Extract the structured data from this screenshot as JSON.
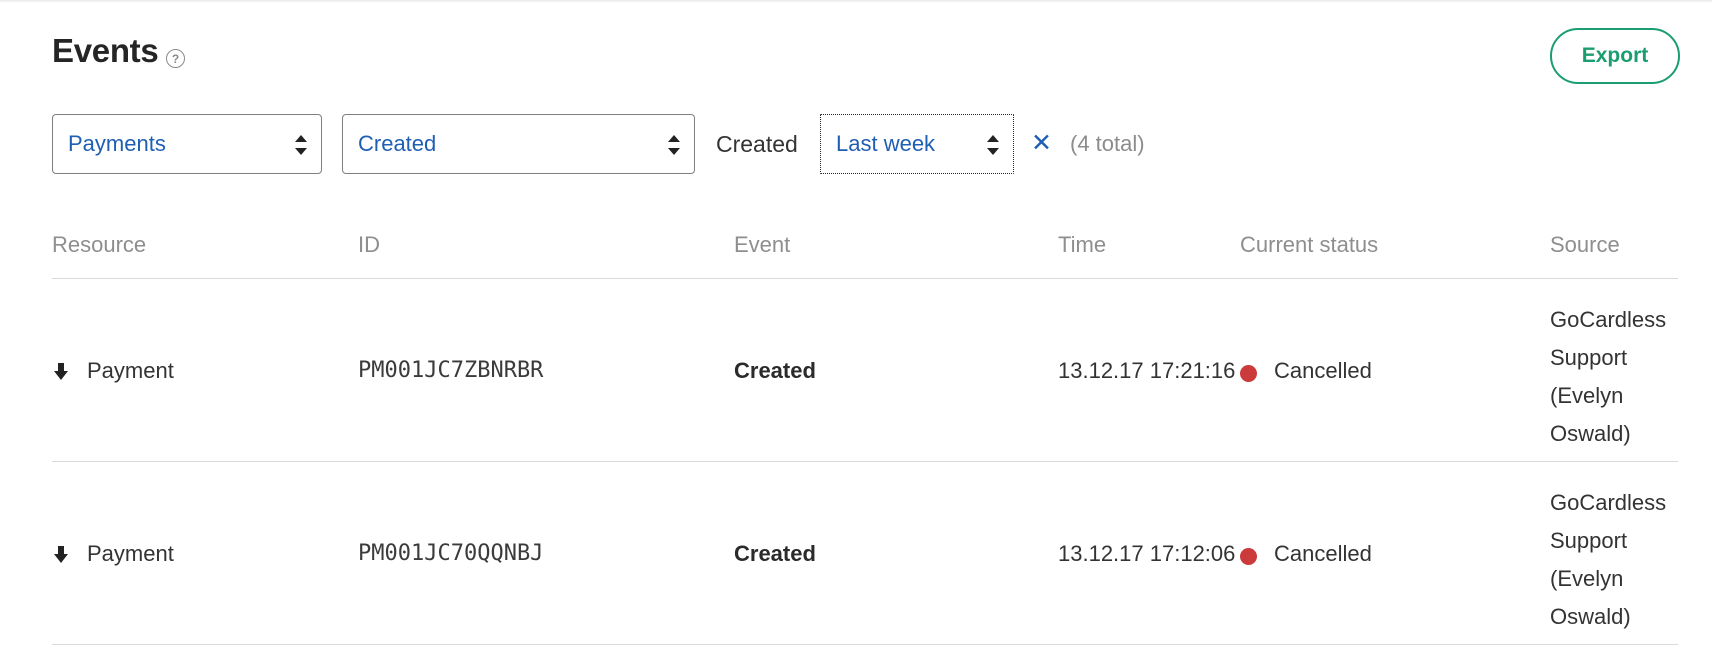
{
  "header": {
    "title": "Events",
    "help_icon": "question-circle-icon",
    "help_glyph": "?",
    "export_label": "Export"
  },
  "filters": {
    "resource_value": "Payments",
    "action_value": "Created",
    "range_label": "Created",
    "range_value": "Last week",
    "clear_icon": "close-icon",
    "clear_glyph": "✕",
    "total_text": "(4 total)"
  },
  "table": {
    "headers": [
      "Resource",
      "ID",
      "Event",
      "Time",
      "Current status",
      "Source"
    ],
    "rows": [
      {
        "resource_icon": "arrow-down-icon",
        "resource": "Payment",
        "id": "PM001JC7ZBNRBR",
        "event": "Created",
        "time": "13.12.17 17:21:16",
        "status": "Cancelled",
        "status_color": "#cc3b3b",
        "source_lines": [
          "GoCardless",
          "Support",
          "(Evelyn",
          "Oswald)"
        ]
      },
      {
        "resource_icon": "arrow-down-icon",
        "resource": "Payment",
        "id": "PM001JC70QQNBJ",
        "event": "Created",
        "time": "13.12.17 17:12:06",
        "status": "Cancelled",
        "status_color": "#cc3b3b",
        "source_lines": [
          "GoCardless",
          "Support",
          "(Evelyn",
          "Oswald)"
        ]
      }
    ]
  },
  "colors": {
    "accent_green": "#1a9e6f",
    "link_blue": "#1e5fb3",
    "muted_text": "#8e8e8e",
    "cancelled_red": "#cc3b3b"
  }
}
